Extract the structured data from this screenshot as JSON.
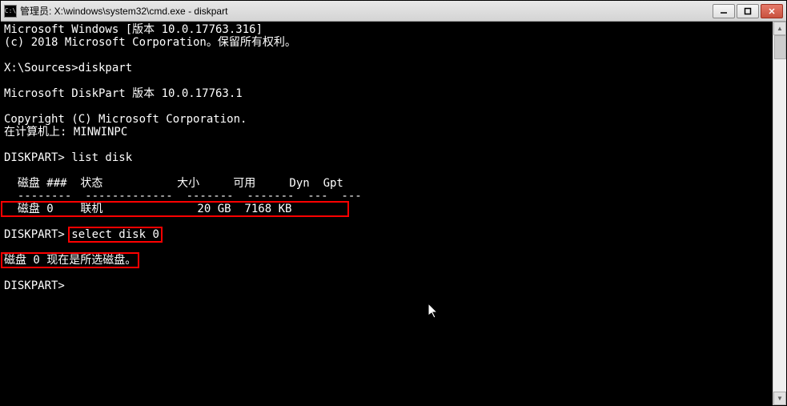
{
  "titlebar": {
    "icon_label": "C:\\",
    "text": "管理员: X:\\windows\\system32\\cmd.exe - diskpart"
  },
  "console": {
    "l1": "Microsoft Windows [版本 10.0.17763.316]",
    "l2": "(c) 2018 Microsoft Corporation。保留所有权利。",
    "l3": "",
    "l4": "X:\\Sources>diskpart",
    "l5": "",
    "l6": "Microsoft DiskPart 版本 10.0.17763.1",
    "l7": "",
    "l8": "Copyright (C) Microsoft Corporation.",
    "l9": "在计算机上: MINWINPC",
    "l10": "",
    "l11": "DISKPART> list disk",
    "l12": "",
    "l13": "  磁盘 ###  状态           大小     可用     Dyn  Gpt",
    "l14": "  --------  -------------  -------  -------  ---  ---",
    "hl_row": "  磁盘 0    联机              20 GB  7168 KB        ",
    "l16": "",
    "prompt2": "DISKPART> ",
    "hl_cmd": "select disk 0",
    "l18": "",
    "hl_msg": "磁盘 0 现在是所选磁盘。",
    "l20": "",
    "l21": "DISKPART>"
  }
}
